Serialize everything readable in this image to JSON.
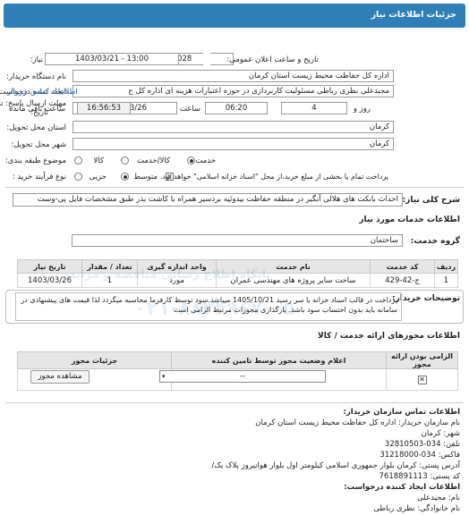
{
  "header": {
    "title": "جزئیات اطلاعات نیاز"
  },
  "form": {
    "need_number_label": "شماره نیاز:",
    "need_number": "1103000121000028",
    "announce_label": "تاریخ و ساعت اعلان عمومی:",
    "announce_value": "1403/03/21 - 13:00",
    "buyer_label": "نام دستگاه خریدار:",
    "buyer_value": "اداره کل حفاظت محیط زیست استان کرمان",
    "creator_label": "ایجاد کننده درخواست:",
    "creator_value": "مجیدعلی نظری رباطی مسئولیت کاربردازی در حوزه اعتبارات هزینه ای اداره کل ح",
    "contact_link": "اطلاعات تماس خریدار",
    "deadline_label_1": "مهلت ارسال پاسخ: تا",
    "deadline_label_2": "تاریخ:",
    "deadline_date": "1403/03/26",
    "time_label": "ساعت",
    "deadline_time": "06:20",
    "days_value": "4",
    "days_label": "روز و",
    "remaining_time": "16:56:53",
    "remaining_label": "ساعت باقی مانده",
    "province_label": "استان محل تحویل:",
    "province_value": "کرمان",
    "city_label": "شهر محل تحویل:",
    "city_value": "کرمان",
    "category_label": "موضوع طبقه بندی:",
    "category_options": [
      "کالا",
      "کالا/خدمت",
      "خدمت"
    ],
    "process_label": "نوع فرآیند خرید :",
    "process_options": [
      "جزیی",
      "متوسط"
    ],
    "process_note": "پرداخت تمام یا بخشی از مبلغ خرید،از محل \"اسناد خزانه اسلامی\" خواهد بود."
  },
  "description": {
    "label": "شرح کلی نیاز:",
    "value": "احداث بانکت های هلالی آبگیر در منطقه حفاظت بیدوئیه بردسیر همراه با کاشت بذر طبق مشخصات فایل پی-وست"
  },
  "services": {
    "section_title": "اطلاعات خدمات مورد نیاز",
    "group_label": "گروه خدمت:",
    "group_value": "ساختمان",
    "columns": [
      "ردیف",
      "کد خدمت",
      "نام خدمت",
      "واحد اندازه گیری",
      "تعداد / مقدار",
      "تاریخ نیاز"
    ],
    "rows": [
      [
        "1",
        "ج-42-429",
        "ساخت سایر پروژه های مهندسی عمران",
        "مورد",
        "1",
        "1403/03/26"
      ]
    ]
  },
  "buyer_notes": {
    "label": "توضیحات خریدار:",
    "value": "پرداخت در قالب اسناد خزانه با سر رسید 1405/10/21 میباشد.سود توسط کارفرما محاسبه میگردد لذا قیمت های پیشنهادی در سامانه باید بدون احتساب سود باشد. بارگذاری مجوزات مرتبط الزامی است"
  },
  "licenses": {
    "section_title": "اطلاعات مجوزهای ارائه خدمت / کالا",
    "columns": [
      "الزامی بودن ارائه مجوز",
      "اعلام وضعیت مجوز توسط تامین کننده",
      "جزئیات مجوز"
    ],
    "select_value": "--",
    "view_button": "مشاهده مجوز"
  },
  "buyer_contact": {
    "section_title": "اطلاعات تماس سازمان خریدار:",
    "name": "نام سازمان خریدار: اداره کل حفاظت محیط زیست استان کرمان",
    "city": "شهر: کرمان",
    "phone1": "تلفن: 034-32810503",
    "phone2": "فاکس: 034-31218000",
    "address": "آدرس پستی: کرمان بلوار جمهوری اسلامی کیلومتر اول بلوار هوانیروز پلاک یک/",
    "postal": "کد پستی: 7618891113",
    "creator_title": "اطلاعات ایجاد کننده درخواست:",
    "creator_name": "نام: مجیدعلی",
    "creator_family": "نام خانوادگی: نظری رباطی"
  },
  "watermark": {
    "text": "پایگاه اطلاع رسانی مناقصه و مزایده",
    "phone": "۰۲۱-۸۸۳۴۹۶۷۰-۵"
  }
}
